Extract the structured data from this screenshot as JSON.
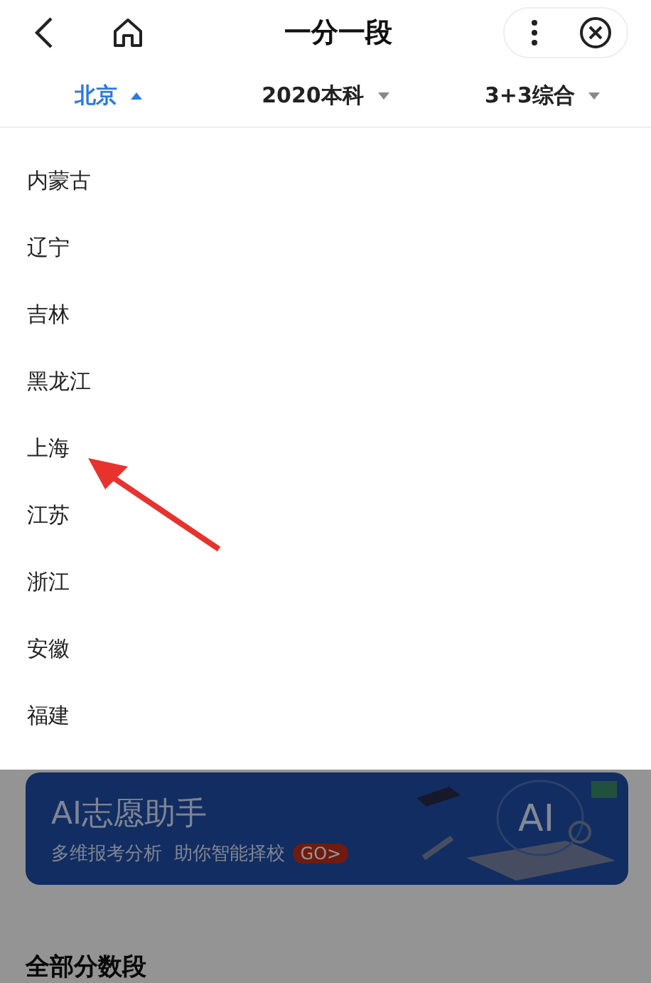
{
  "header": {
    "title": "一分一段"
  },
  "filters": [
    {
      "label": "北京",
      "selected": true
    },
    {
      "label": "2020本科",
      "selected": false
    },
    {
      "label": "3+3综合",
      "selected": false
    }
  ],
  "province_options": [
    {
      "label": "内蒙古"
    },
    {
      "label": "辽宁"
    },
    {
      "label": "吉林"
    },
    {
      "label": "黑龙江"
    },
    {
      "label": "上海"
    },
    {
      "label": "江苏"
    },
    {
      "label": "浙江"
    },
    {
      "label": "安徽"
    },
    {
      "label": "福建"
    }
  ],
  "banner": {
    "title": "AI志愿助手",
    "subtitle": "多维报考分析  助你智能择校",
    "badge": "GO>",
    "logo": "AI"
  },
  "section": {
    "title": "全部分数段"
  }
}
